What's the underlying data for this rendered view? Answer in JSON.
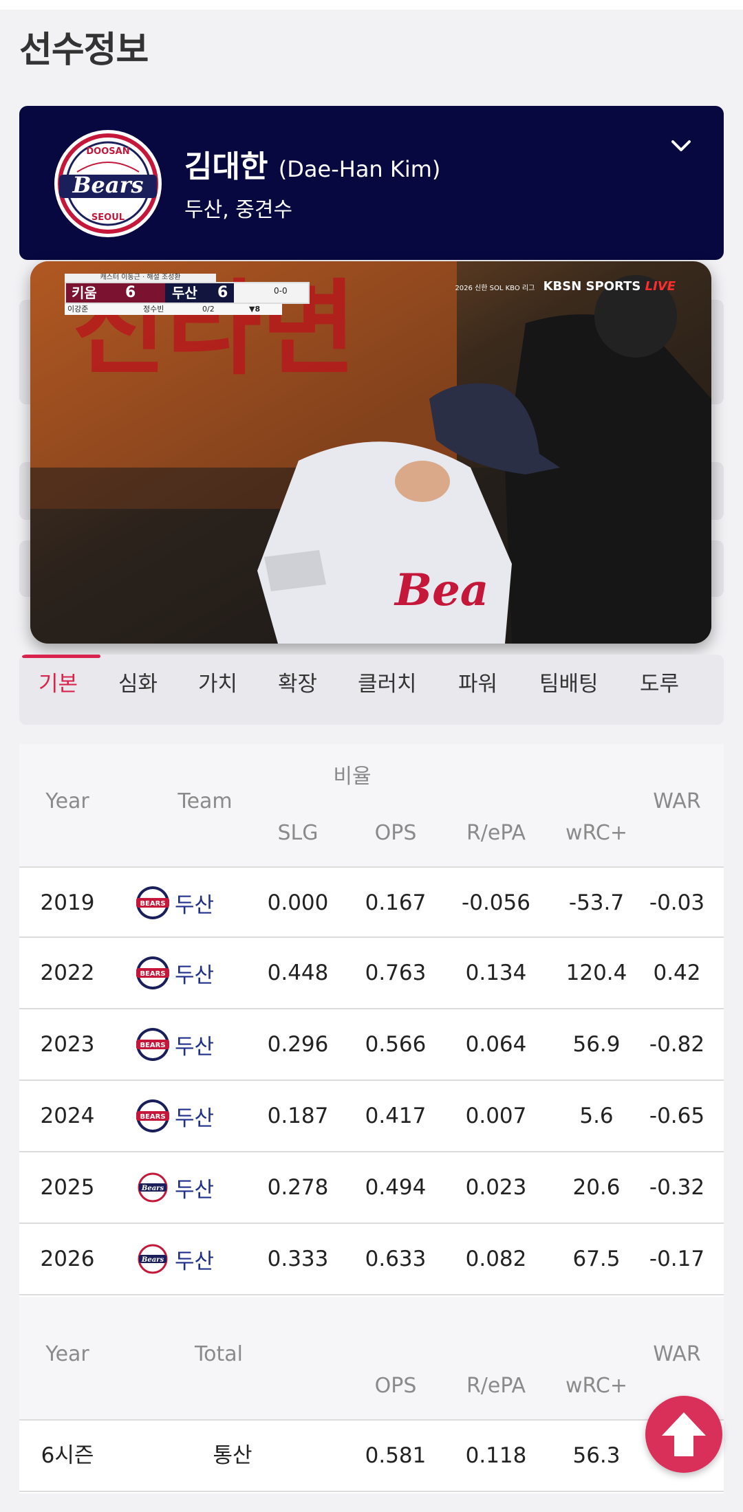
{
  "page": {
    "title": "선수정보"
  },
  "player": {
    "name_ko": "김대한",
    "name_en": "(Dae-Han Kim)",
    "subtitle": "두산, 중견수",
    "logo": {
      "top": "DOOSAN",
      "main": "Bears",
      "bottom": "SEOUL"
    }
  },
  "video": {
    "scorebug": {
      "caption": "캐스터 이동근 · 해설 조성환",
      "team1": "키움",
      "score1": "6",
      "team2": "두산",
      "score2": "6",
      "count": "0-0",
      "pitcher": "이강준",
      "batter": "정수빈",
      "at_bats": "0/2",
      "inning": "▼8"
    },
    "broadcast": {
      "league": "2026 신한 SOL KBO 리그",
      "channel": "KBSN SPORTS",
      "live": "LIVE"
    }
  },
  "tabs": [
    "기본",
    "심화",
    "가치",
    "확장",
    "클러치",
    "파워",
    "팀배팅",
    "도루"
  ],
  "stats": {
    "group_header": "비율",
    "headers": {
      "year": "Year",
      "team": "Team",
      "slg": "SLG",
      "ops": "OPS",
      "repa": "R/ePA",
      "wrc": "wRC+",
      "war": "WAR"
    },
    "rows": [
      {
        "year": "2019",
        "team": "두산",
        "logo": "old",
        "slg": "0.000",
        "ops": "0.167",
        "repa": "-0.056",
        "wrc": "-53.7",
        "war": "-0.03"
      },
      {
        "year": "2022",
        "team": "두산",
        "logo": "old",
        "slg": "0.448",
        "ops": "0.763",
        "repa": "0.134",
        "wrc": "120.4",
        "war": "0.42"
      },
      {
        "year": "2023",
        "team": "두산",
        "logo": "old",
        "slg": "0.296",
        "ops": "0.566",
        "repa": "0.064",
        "wrc": "56.9",
        "war": "-0.82"
      },
      {
        "year": "2024",
        "team": "두산",
        "logo": "old",
        "slg": "0.187",
        "ops": "0.417",
        "repa": "0.007",
        "wrc": "5.6",
        "war": "-0.65"
      },
      {
        "year": "2025",
        "team": "두산",
        "logo": "new",
        "slg": "0.278",
        "ops": "0.494",
        "repa": "0.023",
        "wrc": "20.6",
        "war": "-0.32"
      },
      {
        "year": "2026",
        "team": "두산",
        "logo": "new",
        "slg": "0.333",
        "ops": "0.633",
        "repa": "0.082",
        "wrc": "67.5",
        "war": "-0.17"
      }
    ],
    "total_headers": {
      "year": "Year",
      "total": "Total",
      "ops": "OPS",
      "repa": "R/ePA",
      "wrc": "wRC+",
      "war": "WAR"
    },
    "total_row": {
      "seasons": "6시즌",
      "label": "통산",
      "ops": "0.581",
      "repa": "0.118",
      "wrc": "56.3",
      "war": "-"
    }
  },
  "colors": {
    "navy": "#07083f",
    "accent": "#d9234f",
    "team_blue": "#1f2f8a"
  }
}
